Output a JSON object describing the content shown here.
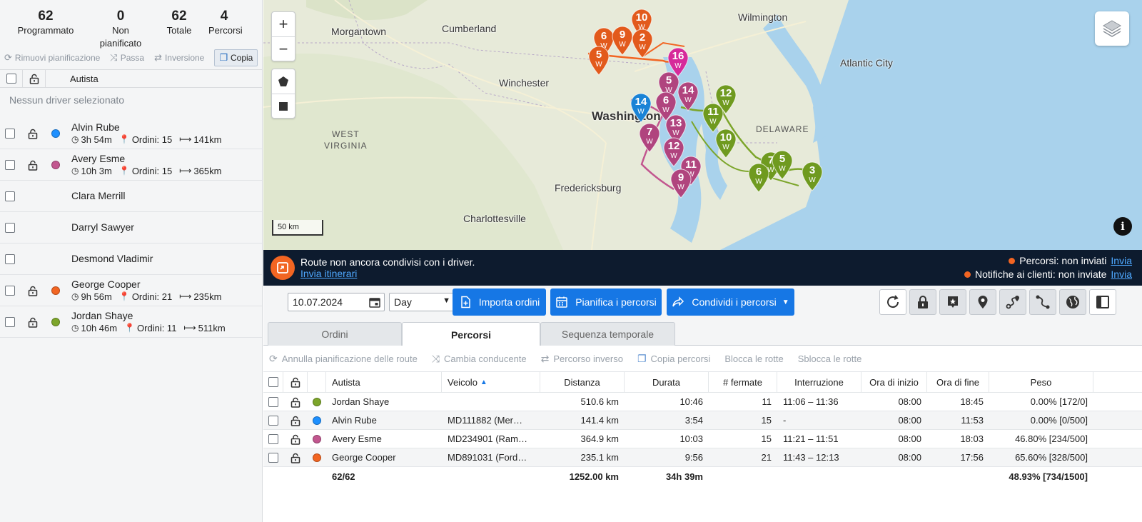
{
  "stats": [
    {
      "num": "62",
      "label": "Programmato"
    },
    {
      "num": "0",
      "label": "Non pianificato"
    },
    {
      "num": "62",
      "label": "Totale"
    },
    {
      "num": "4",
      "label": "Percorsi"
    }
  ],
  "left_tools": {
    "remove": "Rimuovi pianificazione",
    "pass": "Passa",
    "invert": "Inversione",
    "copy": "Copia"
  },
  "left_header": {
    "driver": "Autista"
  },
  "no_driver": "Nessun driver selezionato",
  "drivers": [
    {
      "name": "Alvin Rube",
      "color": "#1e90ff",
      "time": "3h 54m",
      "orders": "Ordini: 15",
      "dist": "141km"
    },
    {
      "name": "Avery Esme",
      "color": "#c2568f",
      "time": "10h 3m",
      "orders": "Ordini: 15",
      "dist": "365km"
    },
    {
      "name": "Clara Merrill"
    },
    {
      "name": "Darryl Sawyer"
    },
    {
      "name": "Desmond Vladimir"
    },
    {
      "name": "George Cooper",
      "color": "#f26522",
      "time": "9h 56m",
      "orders": "Ordini: 21",
      "dist": "235km"
    },
    {
      "name": "Jordan Shaye",
      "color": "#7ca52a",
      "time": "10h 46m",
      "orders": "Ordini: 11",
      "dist": "511km"
    }
  ],
  "map": {
    "cities": {
      "wilmington": "Wilmington",
      "morgantown": "Morgantown",
      "cumberland": "Cumberland",
      "atlantic_city": "Atlantic City",
      "winchester": "Winchester",
      "washington": "Washington",
      "west_virginia_1": "WEST",
      "west_virginia_2": "VIRGINIA",
      "delaware": "DELAWARE",
      "fredericksburg": "Fredericksburg",
      "charlottesville": "Charlottesville"
    },
    "scale": "50 km",
    "pin_label": "W",
    "markers": {
      "orange": [
        "10",
        "6",
        "9",
        "2",
        "5"
      ],
      "magenta": [
        "16"
      ],
      "blue": [
        "14"
      ],
      "purple": [
        "5",
        "14",
        "6",
        "13",
        "7",
        "12",
        "11",
        "9"
      ],
      "green": [
        "12",
        "11",
        "10",
        "7",
        "5",
        "6",
        "3"
      ]
    }
  },
  "banner": {
    "message": "Route non ancora condivisi con i driver.",
    "link": "Invia itinerari",
    "status1": "Percorsi: non inviati",
    "status1_link": "Invia",
    "status2": "Notifiche ai clienti: non inviate",
    "status2_link": "Invia"
  },
  "toolbar": {
    "date": "10.07.2024",
    "period": "Day",
    "import": "Importa ordini",
    "plan": "Pianifica i percorsi",
    "share": "Condividi i percorsi"
  },
  "tabs": [
    "Ordini",
    "Percorsi",
    "Sequenza temporale"
  ],
  "actions": {
    "cancel": "Annulla pianificazione delle route",
    "change": "Cambia conducente",
    "reverse": "Percorso inverso",
    "copy": "Copia percorsi",
    "lock": "Blocca le rotte",
    "unlock": "Sblocca le rotte"
  },
  "table": {
    "headers": {
      "driver": "Autista",
      "vehicle": "Veicolo",
      "distance": "Distanza",
      "duration": "Durata",
      "stops": "# fermate",
      "break": "Interruzione",
      "start": "Ora di inizio",
      "end": "Ora di fine",
      "weight": "Peso"
    },
    "rows": [
      {
        "color": "#7ca52a",
        "driver": "Jordan Shaye",
        "vehicle": "",
        "distance": "510.6 km",
        "duration": "10:46",
        "stops": "11",
        "break": "11:06 – 11:36",
        "start": "08:00",
        "end": "18:45",
        "weight": "0.00% [172/0]"
      },
      {
        "color": "#1e90ff",
        "driver": "Alvin Rube",
        "vehicle": "MD111882 (Mer…",
        "distance": "141.4 km",
        "duration": "3:54",
        "stops": "15",
        "break": "-",
        "start": "08:00",
        "end": "11:53",
        "weight": "0.00% [0/500]"
      },
      {
        "color": "#c2568f",
        "driver": "Avery Esme",
        "vehicle": "MD234901 (Ram…",
        "distance": "364.9 km",
        "duration": "10:03",
        "stops": "15",
        "break": "11:21 – 11:51",
        "start": "08:00",
        "end": "18:03",
        "weight": "46.80% [234/500]"
      },
      {
        "color": "#f26522",
        "driver": "George Cooper",
        "vehicle": "MD891031 (Ford…",
        "distance": "235.1 km",
        "duration": "9:56",
        "stops": "21",
        "break": "11:43 – 12:13",
        "start": "08:00",
        "end": "17:56",
        "weight": "65.60% [328/500]"
      }
    ],
    "total": {
      "driver": "62/62",
      "distance": "1252.00 km",
      "duration": "34h 39m",
      "weight": "48.93% [734/1500]"
    }
  }
}
